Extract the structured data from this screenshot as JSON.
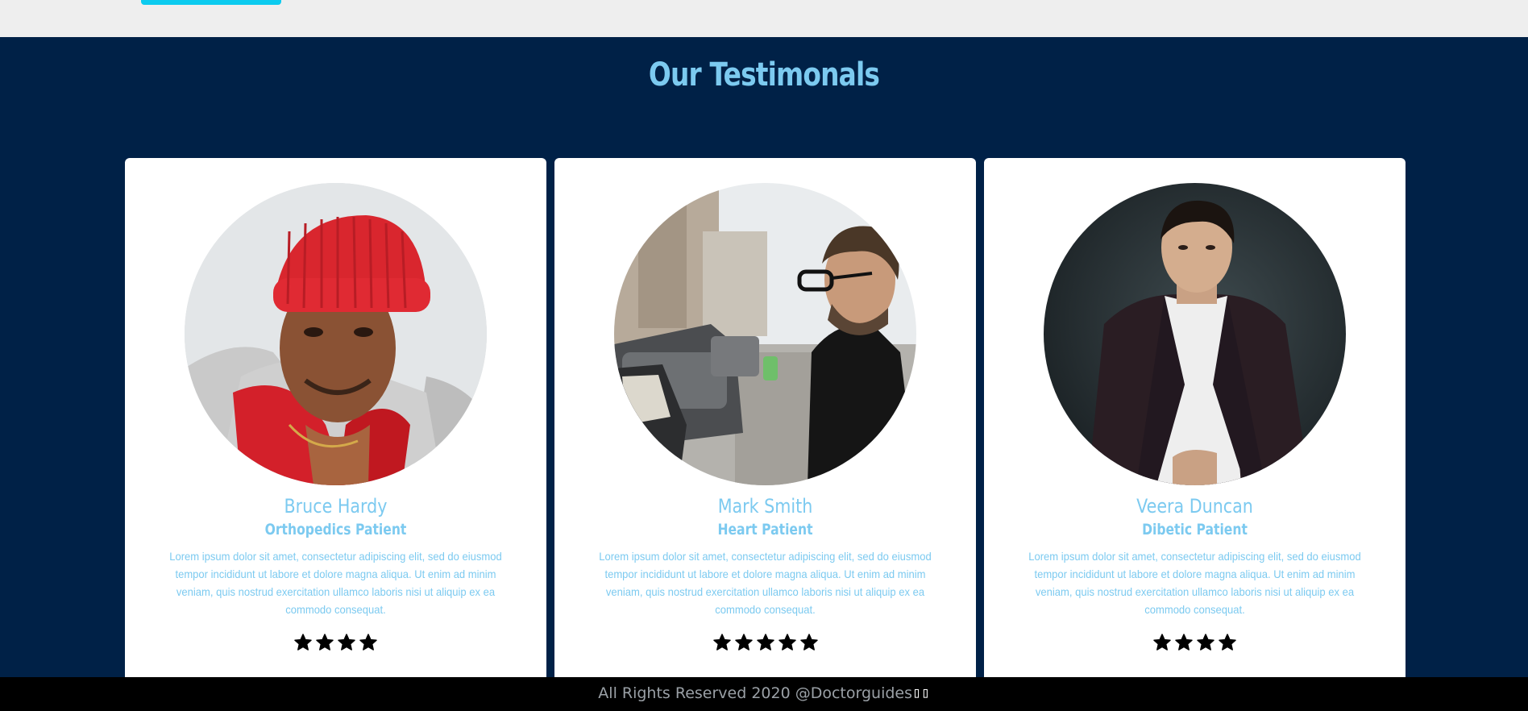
{
  "header": {
    "button_color": "#0ccbef"
  },
  "testimonials": {
    "title": "Our Testimonals",
    "cards": [
      {
        "name": "Bruce Hardy",
        "role": "Orthopedics Patient",
        "text": "Lorem ipsum dolor sit amet, consectetur adipiscing elit, sed do eiusmod tempor incididunt ut labore et dolore magna aliqua. Ut enim ad minim veniam, quis nostrud exercitation ullamco laboris nisi ut aliquip ex ea commodo consequat.",
        "rating": 4,
        "photo": "man-red-beanie-photo"
      },
      {
        "name": "Mark Smith",
        "role": "Heart Patient",
        "text": "Lorem ipsum dolor sit amet, consectetur adipiscing elit, sed do eiusmod tempor incididunt ut labore et dolore magna aliqua. Ut enim ad minim veniam, quis nostrud exercitation ullamco laboris nisi ut aliquip ex ea commodo consequat.",
        "rating": 5,
        "photo": "man-glasses-street-photo"
      },
      {
        "name": "Veera Duncan",
        "role": "Dibetic Patient",
        "text": "Lorem ipsum dolor sit amet, consectetur adipiscing elit, sed do eiusmod tempor incididunt ut labore et dolore magna aliqua. Ut enim ad minim veniam, quis nostrud exercitation ullamco laboris nisi ut aliquip ex ea commodo consequat.",
        "rating": 4,
        "photo": "man-blazer-photo"
      }
    ]
  },
  "footer": {
    "text": "All Rights Reserved 2020 @Doctorguides",
    "trailing_glyphs": "▯▯"
  },
  "colors": {
    "section_bg": "#002147",
    "accent_text": "#7ccaf0",
    "card_bg": "#ffffff",
    "footer_bg": "#000000",
    "star": "#000000"
  }
}
